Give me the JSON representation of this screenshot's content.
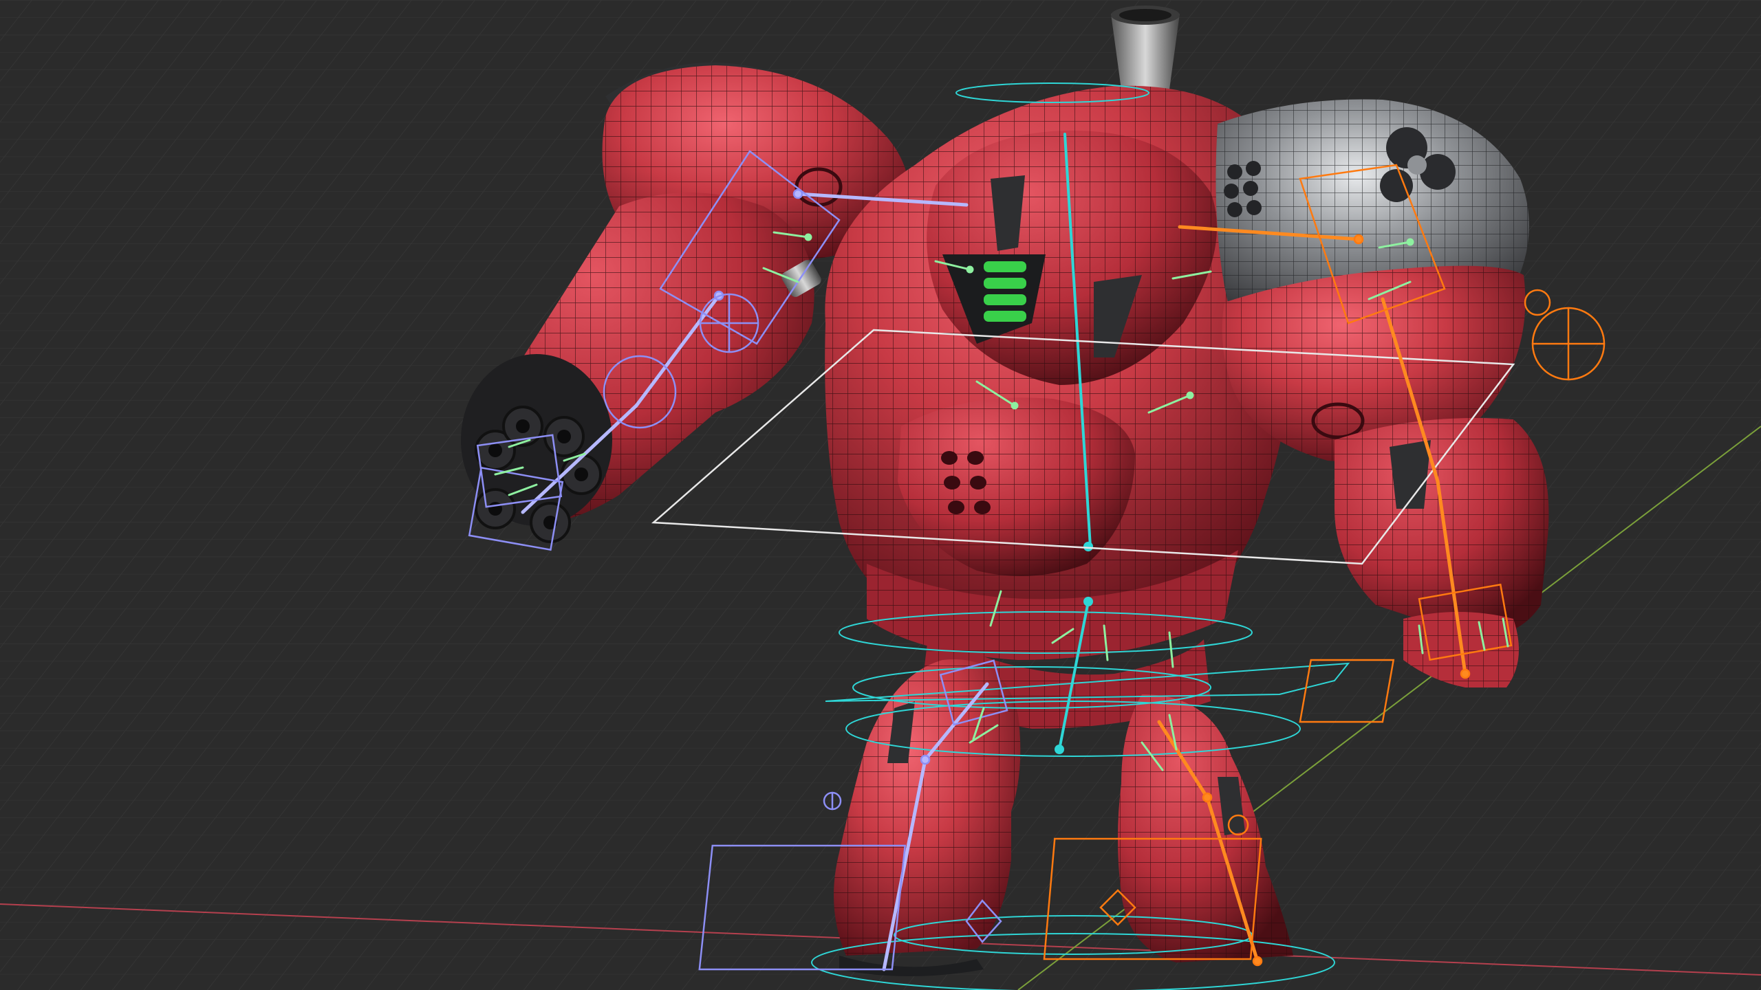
{
  "viewport": {
    "background": "#2b2b2b",
    "grid_color": "#3a3a3a",
    "x_axis_color": "#b5404e",
    "y_axis_color": "#7ba03a"
  },
  "colors": {
    "armor_red": "#c83a45",
    "armor_red_dark": "#7a1820",
    "armor_shadow": "#4a0e14",
    "metal_gray": "#8f9296",
    "metal_dark": "#2a2b2e",
    "visor_green": "#39d04a",
    "rig_cyan": "#2fd6d6",
    "rig_blue": "#8d8ff5",
    "rig_orange": "#ff7a10",
    "bone_green": "#8ef0a0",
    "wire": "#2a0a0d"
  },
  "icons": {
    "hip_circle": "circle-icon",
    "target_gizmo": "crosshair-icon"
  }
}
